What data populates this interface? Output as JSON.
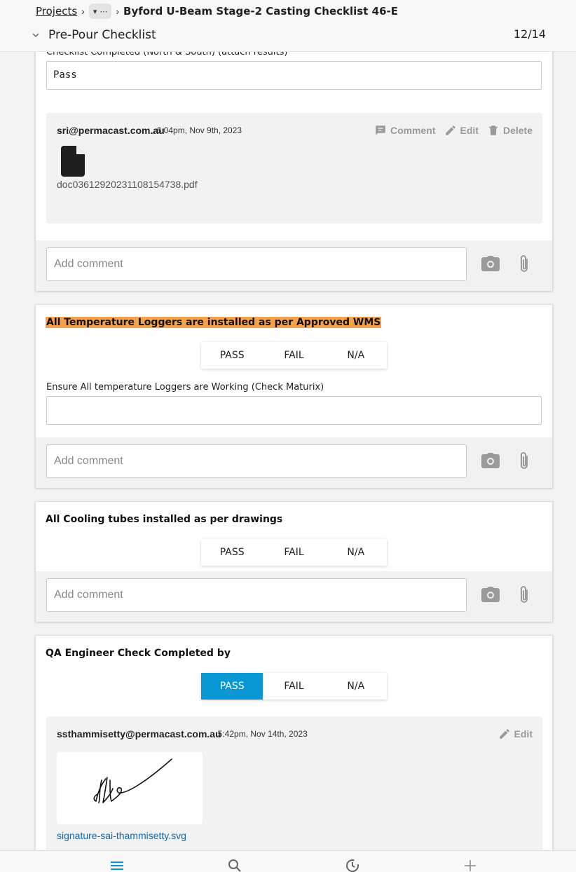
{
  "header": {
    "breadcrumb_root": "Projects",
    "breadcrumb_more": "⋯",
    "breadcrumb_current": "Byford U-Beam Stage-2 Casting Checklist 46-E",
    "section_title": "Pre-Pour Checklist",
    "progress": "12/14"
  },
  "card1": {
    "partial_label": "Checklist Completed (North & South) (attach results)",
    "text_value": "Pass",
    "entry": {
      "author": "sri@permacast.com.au",
      "time": ", 6:04pm, Nov 9th, 2023",
      "comment_label": "Comment",
      "edit_label": "Edit",
      "delete_label": "Delete",
      "file_name": "doc03612920231108154738.pdf"
    },
    "comment_placeholder": "Add comment"
  },
  "card2": {
    "question": "All Temperature Loggers are installed as per Approved WMS",
    "options": [
      "PASS",
      "FAIL",
      "N/A"
    ],
    "field_label": "Ensure All temperature Loggers are Working (Check Maturix)",
    "text_value": "",
    "comment_placeholder": "Add comment"
  },
  "card3": {
    "question": "All Cooling tubes installed as per drawings",
    "options": [
      "PASS",
      "FAIL",
      "N/A"
    ],
    "comment_placeholder": "Add comment"
  },
  "card4": {
    "question": "QA Engineer Check Completed by",
    "options": [
      "PASS",
      "FAIL",
      "N/A"
    ],
    "selected": "PASS",
    "entry": {
      "author": "ssthammisetty@permacast.com.au",
      "time": ", 5:42pm, Nov 14th, 2023",
      "edit_label": "Edit",
      "file_name": "signature-sai-thammisetty.svg"
    }
  },
  "colors": {
    "accent": "#0996d4",
    "highlight": "#f6a24a",
    "link": "#1565a8"
  },
  "bottom_nav": {
    "icons": [
      "menu-icon",
      "search-icon",
      "history-icon",
      "add-icon"
    ]
  }
}
